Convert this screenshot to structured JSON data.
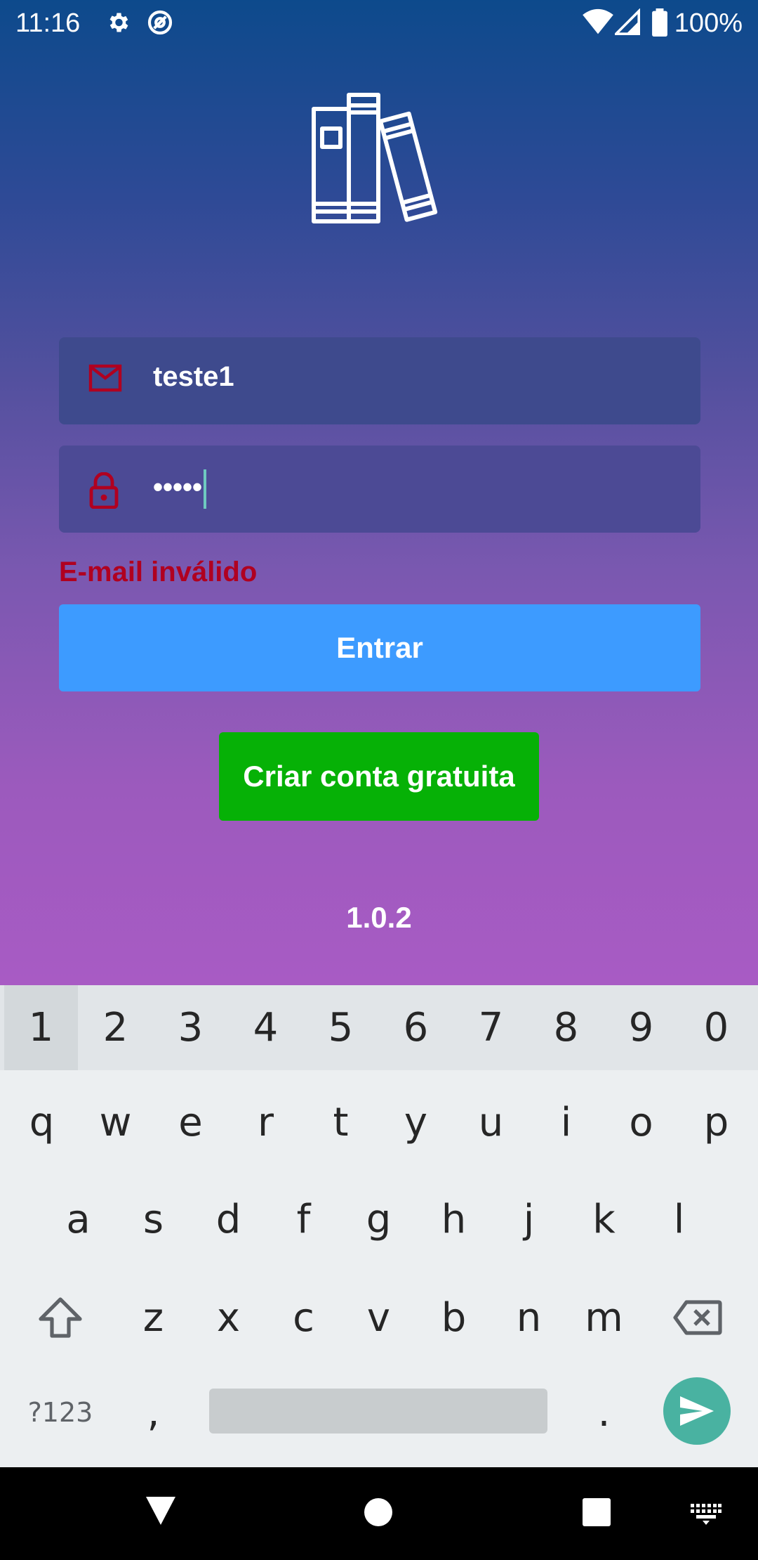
{
  "status_bar": {
    "time": "11:16",
    "battery": "100%"
  },
  "login": {
    "email_value": "teste1",
    "password_value": "•••••",
    "error_message": "E-mail inválido",
    "login_button": "Entrar",
    "create_account_button": "Criar conta gratuita",
    "version": "1.0.2"
  },
  "keyboard": {
    "number_row": [
      "1",
      "2",
      "3",
      "4",
      "5",
      "6",
      "7",
      "8",
      "9",
      "0"
    ],
    "row1": [
      "q",
      "w",
      "e",
      "r",
      "t",
      "y",
      "u",
      "i",
      "o",
      "p"
    ],
    "row2": [
      "a",
      "s",
      "d",
      "f",
      "g",
      "h",
      "j",
      "k",
      "l"
    ],
    "row3": [
      "z",
      "x",
      "c",
      "v",
      "b",
      "n",
      "m"
    ],
    "symbols_key": "?123",
    "comma_key": ",",
    "period_key": "."
  },
  "colors": {
    "accent_blue": "#3d9bff",
    "accent_green": "#06b106",
    "error_red": "#b00020"
  }
}
